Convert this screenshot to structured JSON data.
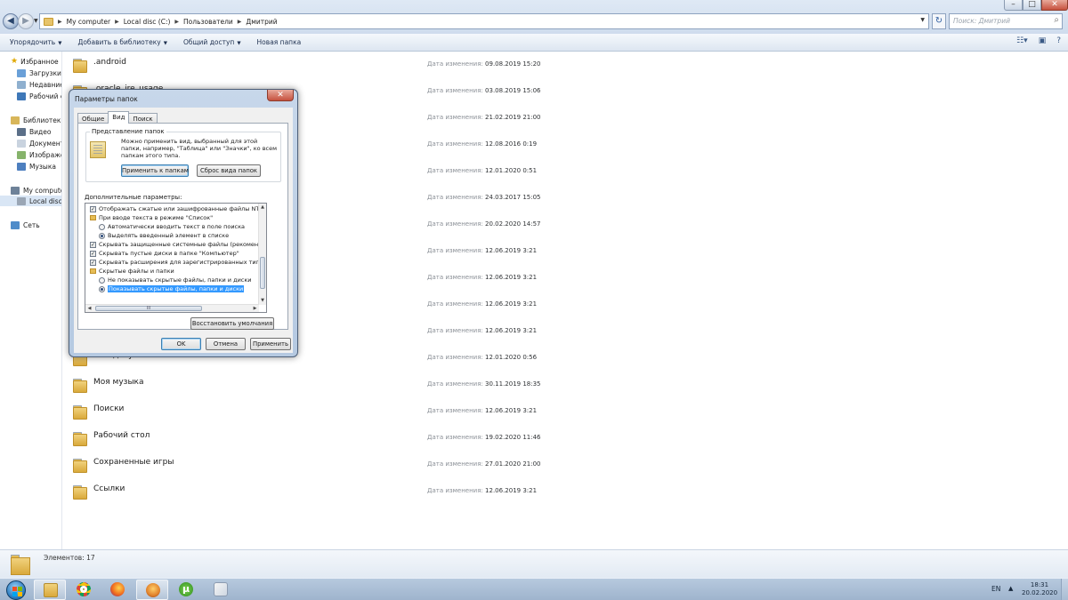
{
  "address_bar": {
    "path": [
      "My computer",
      "Local disc (C:)",
      "Пользователи",
      "Дмитрий"
    ],
    "search_placeholder": "Поиск: Дмитрий"
  },
  "toolbar": {
    "organize": "Упорядочить",
    "add_to_library": "Добавить в библиотеку",
    "share": "Общий доступ",
    "new_folder": "Новая папка"
  },
  "nav": {
    "favorites": "Избранное",
    "downloads": "Загрузки",
    "recent": "Недавние места",
    "desktop": "Рабочий стол",
    "libraries": "Библиотеки",
    "video": "Видео",
    "documents": "Документы",
    "images": "Изображения",
    "music": "Музыка",
    "computer": "My computer",
    "local_disc": "Local disc (C:)",
    "network": "Сеть"
  },
  "files": {
    "date_label": "Дата изменения:",
    "items": [
      {
        "name": ".android",
        "date": "09.08.2019 15:20"
      },
      {
        "name": ".oracle_jre_usage",
        "date": "03.08.2019 15:06"
      },
      {
        "name": "",
        "date": "21.02.2019 21:00"
      },
      {
        "name": "",
        "date": "12.08.2016 0:19"
      },
      {
        "name": "",
        "date": "12.01.2020 0:51"
      },
      {
        "name": "",
        "date": "24.03.2017 15:05"
      },
      {
        "name": "",
        "date": "20.02.2020 14:57"
      },
      {
        "name": "",
        "date": "12.06.2019 3:21"
      },
      {
        "name": "",
        "date": "12.06.2019 3:21"
      },
      {
        "name": "",
        "date": "12.06.2019 3:21"
      },
      {
        "name": "",
        "date": "12.06.2019 3:21"
      },
      {
        "name": "Мои документы",
        "date": "12.01.2020 0:56"
      },
      {
        "name": "Моя музыка",
        "date": "30.11.2019 18:35"
      },
      {
        "name": "Поиски",
        "date": "12.06.2019 3:21"
      },
      {
        "name": "Рабочий стол",
        "date": "19.02.2020 11:46"
      },
      {
        "name": "Сохраненные игры",
        "date": "27.01.2020 21:00"
      },
      {
        "name": "Ссылки",
        "date": "12.06.2019 3:21"
      }
    ]
  },
  "status": {
    "count": "Элементов: 17"
  },
  "dialog": {
    "title": "Параметры папок",
    "tabs": [
      "Общие",
      "Вид",
      "Поиск"
    ],
    "group_title": "Представление папок",
    "group_text": "Можно применить вид, выбранный для этой папки, например, \"Таблица\" или \"Значки\", ко всем папкам этого типа.",
    "apply_to_folders": "Применить к папкам",
    "reset_view": "Сброс вида папок",
    "advanced_label": "Дополнительные параметры:",
    "tree": [
      {
        "kind": "check",
        "checked": true,
        "indent": 0,
        "text": "Отображать сжатые или зашифрованные файлы NTFS"
      },
      {
        "kind": "folder",
        "indent": 0,
        "text": "При вводе текста в режиме \"Список\""
      },
      {
        "kind": "radio",
        "checked": false,
        "indent": 1,
        "text": "Автоматически вводить текст в поле поиска"
      },
      {
        "kind": "radio",
        "checked": true,
        "indent": 1,
        "text": "Выделять введенный элемент в списке"
      },
      {
        "kind": "check",
        "checked": true,
        "indent": 0,
        "text": "Скрывать защищенные системные файлы (рекомендуется)"
      },
      {
        "kind": "check",
        "checked": true,
        "indent": 0,
        "text": "Скрывать пустые диски в папке \"Компьютер\""
      },
      {
        "kind": "check",
        "checked": true,
        "indent": 0,
        "text": "Скрывать расширения для зарегистрированных типов файлов"
      },
      {
        "kind": "folder",
        "indent": 0,
        "text": "Скрытые файлы и папки"
      },
      {
        "kind": "radio",
        "checked": false,
        "indent": 1,
        "text": "Не показывать скрытые файлы, папки и диски"
      },
      {
        "kind": "radio",
        "checked": true,
        "indent": 1,
        "text": "Показывать скрытые файлы, папки и диски",
        "selected": true
      }
    ],
    "scroll_grip": "III",
    "restore_defaults": "Восстановить умолчания",
    "ok": "OK",
    "cancel": "Отмена",
    "apply": "Применить"
  },
  "taskbar": {
    "lang": "EN",
    "time": "18:31",
    "date": "20.02.2020"
  },
  "colors": {
    "selection": "#3399ff",
    "folder": "#e6bd55",
    "close_button": "#c6513e"
  }
}
